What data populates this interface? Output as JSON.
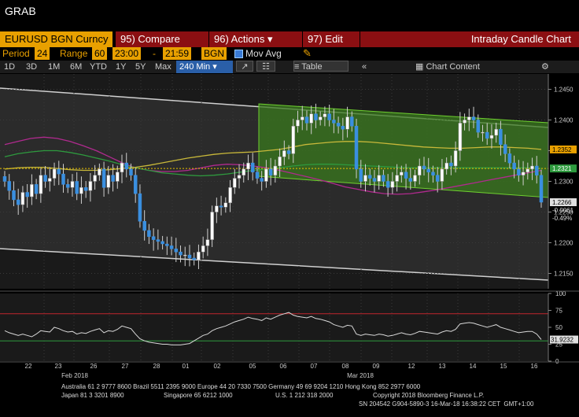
{
  "app": {
    "grab_label": "GRAB"
  },
  "menubar": {
    "ticker": "EURUSD BGN Curncy",
    "compare": "95) Compare",
    "actions": "96) Actions",
    "edit": "97) Edit",
    "chart_title": "Intraday Candle Chart"
  },
  "params": {
    "period_label": "Period",
    "period_value": "24",
    "range_label": "Range",
    "range_value": "60",
    "range_start": "23:00",
    "range_sep": "-",
    "range_end": "21:59",
    "source": "BGN",
    "mov_avg_label": "Mov Avg",
    "pencil_icon": "pencil-icon"
  },
  "toolbar": {
    "periods": [
      "1D",
      "3D",
      "1M",
      "6M",
      "YTD",
      "1Y",
      "5Y",
      "Max"
    ],
    "interval": "240 Min",
    "table_label": "Table",
    "chart_content_label": "Chart Content"
  },
  "colors": {
    "up_candle": "#ffffff",
    "down_candle": "#3a8fe0",
    "channel_fill": "#3a7a1e",
    "channel_border": "#6fd030",
    "ma_magenta": "#b02a8e",
    "ma_green": "#2e9a3e",
    "ma_yellow": "#c8b83a",
    "last_price_tag": "#e0e0e0",
    "tag_orange": "#e8a000",
    "tag_green": "#2e9a3e",
    "rsi_line": "#d8d8d8",
    "rsi_upper": "#c0262d",
    "rsi_lower": "#2e9a3e"
  },
  "chart_data": {
    "type": "candlestick",
    "symbol": "EURUSD BGN Curncy",
    "interval": "240 Min",
    "ylim": [
      1.2125,
      1.2475
    ],
    "y_ticks": [
      1.215,
      1.22,
      1.225,
      1.23,
      1.235,
      1.24,
      1.245
    ],
    "y_tick_labels": [
      "1.2150",
      "1.2200",
      "1.2250",
      "1.2300",
      "1.2350",
      "1.2400",
      "1.2450"
    ],
    "x_day_labels": [
      "22",
      "23",
      "26",
      "27",
      "28",
      "01",
      "02",
      "05",
      "06",
      "07",
      "08",
      "09",
      "12",
      "13",
      "14",
      "15",
      "16"
    ],
    "x_month_labels": [
      "Feb 2018",
      "Mar 2018"
    ],
    "price_tags": [
      {
        "label": "1.2352",
        "value": 1.2352,
        "color": "orange"
      },
      {
        "label": "1.2321",
        "value": 1.2321,
        "color": "green"
      },
      {
        "label": "1.2266",
        "value": 1.2266,
        "color": "white"
      },
      {
        "label": "-0.0061",
        "value": -0.0061,
        "color": "none"
      },
      {
        "label": "-0.49%",
        "value": -0.49,
        "color": "none"
      }
    ],
    "close_series": [
      1.23,
      1.2285,
      1.227,
      1.2262,
      1.2282,
      1.2275,
      1.2295,
      1.228,
      1.231,
      1.23,
      1.2305,
      1.232,
      1.2312,
      1.2295,
      1.229,
      1.23,
      1.228,
      1.229,
      1.2285,
      1.23,
      1.231,
      1.232,
      1.229,
      1.231,
      1.23,
      1.2315,
      1.233,
      1.232,
      1.231,
      1.228,
      1.2235,
      1.222,
      1.221,
      1.2205,
      1.2202,
      1.2198,
      1.2195,
      1.219,
      1.2185,
      1.218,
      1.218,
      1.2175,
      1.2172,
      1.2185,
      1.2195,
      1.2205,
      1.225,
      1.226,
      1.2258,
      1.2265,
      1.229,
      1.2305,
      1.231,
      1.232,
      1.233,
      1.2315,
      1.2305,
      1.23,
      1.232,
      1.231,
      1.2325,
      1.234,
      1.235,
      1.2345,
      1.239,
      1.24,
      1.2405,
      1.2395,
      1.241,
      1.24,
      1.2405,
      1.241,
      1.24,
      1.2395,
      1.239,
      1.2385,
      1.2405,
      1.239,
      1.232,
      1.23,
      1.231,
      1.2305,
      1.23,
      1.231,
      1.23,
      1.229,
      1.23,
      1.231,
      1.2315,
      1.2305,
      1.23,
      1.231,
      1.2325,
      1.232,
      1.2315,
      1.231,
      1.23,
      1.232,
      1.233,
      1.2325,
      1.235,
      1.2395,
      1.24,
      1.2405,
      1.24,
      1.238,
      1.238,
      1.237,
      1.2375,
      1.2385,
      1.236,
      1.2345,
      1.233,
      1.232,
      1.231,
      1.2315,
      1.232,
      1.2325,
      1.231,
      1.2266
    ],
    "ma_magenta": [
      1.236,
      1.2365,
      1.237,
      1.2372,
      1.237,
      1.2365,
      1.2358,
      1.235,
      1.234,
      1.233,
      1.2322,
      1.2318,
      1.2316,
      1.2316,
      1.2318,
      1.2322,
      1.2326,
      1.2328,
      1.2327,
      1.2325,
      1.2322,
      1.2318,
      1.2313,
      1.2308,
      1.2303,
      1.2297,
      1.2291,
      1.2287,
      1.2283,
      1.228,
      1.2279,
      1.228,
      1.2283,
      1.2286,
      1.229,
      1.2294,
      1.2298,
      1.2302,
      1.2306,
      1.231,
      1.2314,
      1.2318
    ],
    "ma_green": [
      1.234,
      1.2345,
      1.2348,
      1.235,
      1.235,
      1.2347,
      1.2343,
      1.2338,
      1.2333,
      1.2327,
      1.2322,
      1.2318,
      1.2314,
      1.2312,
      1.231,
      1.2309,
      1.231,
      1.2312,
      1.2315,
      1.2318,
      1.232,
      1.2322,
      1.2325,
      1.2327,
      1.2328,
      1.2328,
      1.2327,
      1.2326,
      1.2325,
      1.2324,
      1.2323,
      1.2322,
      1.2322,
      1.2322,
      1.2322,
      1.2322,
      1.2322,
      1.2322,
      1.2322,
      1.2322,
      1.2322,
      1.2321
    ],
    "ma_yellow": [
      1.232,
      1.2322,
      1.2323,
      1.2323,
      1.2321,
      1.2319,
      1.2318,
      1.2318,
      1.2319,
      1.2321,
      1.2323,
      1.2326,
      1.233,
      1.2334,
      1.2338,
      1.2341,
      1.2344,
      1.2346,
      1.2347,
      1.2348,
      1.235,
      1.2352,
      1.2356,
      1.236,
      1.2362,
      1.2364,
      1.2365,
      1.2365,
      1.2364,
      1.2362,
      1.236,
      1.2358,
      1.2356,
      1.2355,
      1.2354,
      1.2354,
      1.2355,
      1.2356,
      1.2356,
      1.2355,
      1.2354,
      1.2352
    ],
    "rsi_panel": {
      "ylim": [
        0,
        100
      ],
      "y_ticks": [
        0,
        25,
        50,
        75,
        100
      ],
      "y_tick_labels": [
        "0",
        "25",
        "50",
        "75",
        "100"
      ],
      "upper_level": 70,
      "lower_level": 30,
      "last_value_label": "31.9232",
      "values": [
        45,
        42,
        40,
        38,
        40,
        38,
        36,
        40,
        45,
        44,
        43,
        50,
        48,
        45,
        43,
        44,
        40,
        42,
        41,
        44,
        46,
        48,
        42,
        45,
        44,
        47,
        52,
        50,
        48,
        40,
        33,
        30,
        28,
        27,
        26,
        25,
        25,
        24,
        24,
        24,
        25,
        26,
        30,
        34,
        38,
        40,
        45,
        48,
        50,
        52,
        55,
        58,
        60,
        62,
        65,
        63,
        62,
        60,
        64,
        62,
        65,
        68,
        70,
        72,
        68,
        66,
        65,
        64,
        66,
        63,
        62,
        60,
        58,
        54,
        52,
        50,
        53,
        52,
        40,
        38,
        40,
        39,
        38,
        40,
        39,
        37,
        38,
        40,
        42,
        40,
        39,
        41,
        44,
        43,
        42,
        41,
        40,
        43,
        45,
        44,
        47,
        55,
        56,
        57,
        56,
        54,
        52,
        50,
        52,
        54,
        50,
        48,
        46,
        44,
        42,
        43,
        44,
        44,
        40,
        32
      ]
    }
  },
  "footer": {
    "line1": "Australia 61 2 9777 8600 Brazil 5511 2395 9000 Europe 44 20 7330 7500 Germany 49 69 9204 1210 Hong Kong 852 2977 6000",
    "line2a": "Japan 81 3 3201 8900",
    "line2b": "Singapore 65 6212 1000",
    "line2c": "U.S. 1 212 318 2000",
    "line2d": "Copyright 2018 Bloomberg Finance L.P.",
    "line3": "SN 204542 G904-5890-3 16-Mar-18 16:38:22 CET  GMT+1:00"
  }
}
